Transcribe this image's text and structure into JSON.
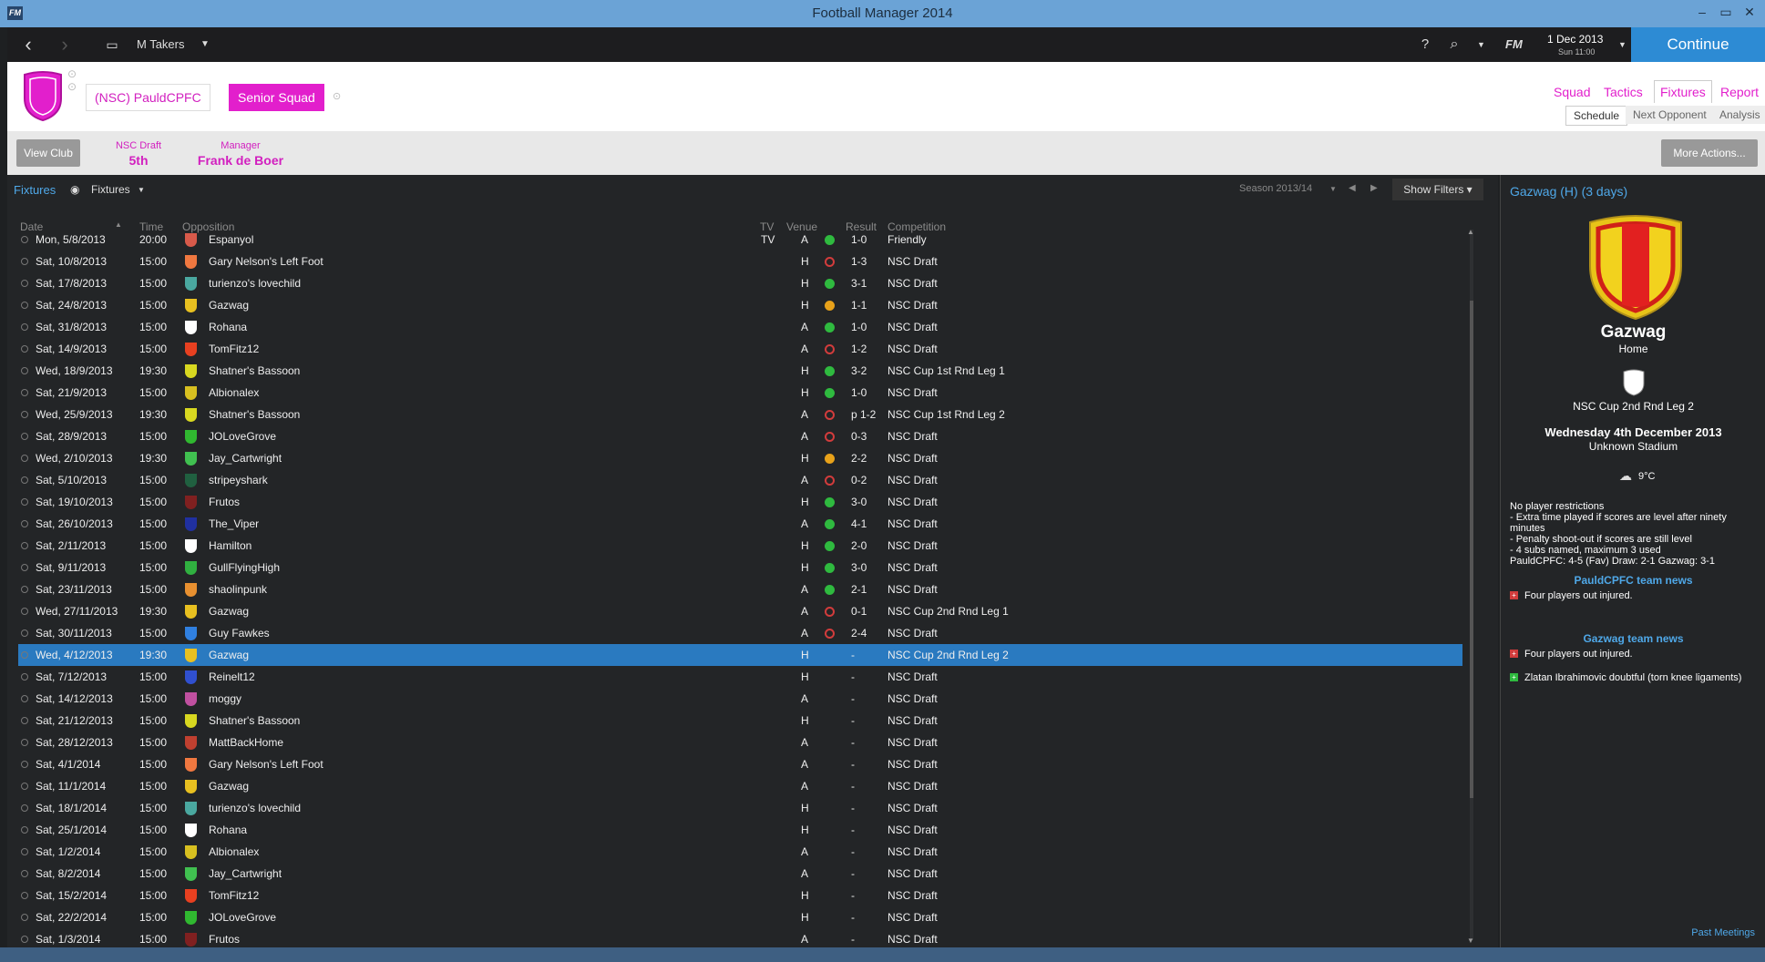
{
  "window": {
    "title": "Football Manager 2014",
    "logo": "FM"
  },
  "topnav": {
    "manager": "M Takers",
    "date": "1 Dec 2013",
    "time": "Sun 11:00",
    "fm_label": "FM",
    "continue": "Continue"
  },
  "club": {
    "name": "(NSC) PauldCPFC",
    "squad": "Senior Squad",
    "crest_color": "#e21fcc",
    "tabs": [
      "Squad",
      "Tactics",
      "Fixtures",
      "Report"
    ],
    "subtabs": [
      "Schedule",
      "Next Opponent",
      "Analysis"
    ]
  },
  "infobar": {
    "view_club": "View Club",
    "comp_label": "NSC Draft",
    "comp_value": "5th",
    "manager_label": "Manager",
    "manager_value": "Frank de Boer",
    "more_actions": "More Actions..."
  },
  "fixtures": {
    "breadcrumb": "Fixtures",
    "view": "Fixtures",
    "season": "Season 2013/14",
    "filters": "Show Filters",
    "columns": {
      "date": "Date",
      "time": "Time",
      "opposition": "Opposition",
      "tv": "TV",
      "venue": "Venue",
      "result": "Result",
      "competition": "Competition"
    },
    "rows": [
      {
        "date": "Mon, 5/8/2013",
        "time": "20:00",
        "opp": "Espanyol",
        "tv": "TV",
        "venue": "A",
        "outcome": "W",
        "result": "1-0",
        "comp": "Friendly",
        "crest": "#d85a4a"
      },
      {
        "date": "Sat, 10/8/2013",
        "time": "15:00",
        "opp": "Gary Nelson's Left Foot",
        "tv": "",
        "venue": "H",
        "outcome": "L",
        "result": "1-3",
        "comp": "NSC Draft",
        "crest": "#f07840"
      },
      {
        "date": "Sat, 17/8/2013",
        "time": "15:00",
        "opp": "turienzo's lovechild",
        "tv": "",
        "venue": "H",
        "outcome": "W",
        "result": "3-1",
        "comp": "NSC Draft",
        "crest": "#4aa8a0"
      },
      {
        "date": "Sat, 24/8/2013",
        "time": "15:00",
        "opp": "Gazwag",
        "tv": "",
        "venue": "H",
        "outcome": "D",
        "result": "1-1",
        "comp": "NSC Draft",
        "crest": "#e8c020"
      },
      {
        "date": "Sat, 31/8/2013",
        "time": "15:00",
        "opp": "Rohana",
        "tv": "",
        "venue": "A",
        "outcome": "W",
        "result": "1-0",
        "comp": "NSC Draft",
        "crest": "#ffffff"
      },
      {
        "date": "Sat, 14/9/2013",
        "time": "15:00",
        "opp": "TomFitz12",
        "tv": "",
        "venue": "A",
        "outcome": "L",
        "result": "1-2",
        "comp": "NSC Draft",
        "crest": "#e84020"
      },
      {
        "date": "Wed, 18/9/2013",
        "time": "19:30",
        "opp": "Shatner's Bassoon",
        "tv": "",
        "venue": "H",
        "outcome": "W",
        "result": "3-2",
        "comp": "NSC Cup 1st Rnd Leg 1",
        "crest": "#d8d820"
      },
      {
        "date": "Sat, 21/9/2013",
        "time": "15:00",
        "opp": "Albionalex",
        "tv": "",
        "venue": "H",
        "outcome": "W",
        "result": "1-0",
        "comp": "NSC Draft",
        "crest": "#d8c020"
      },
      {
        "date": "Wed, 25/9/2013",
        "time": "19:30",
        "opp": "Shatner's Bassoon",
        "tv": "",
        "venue": "A",
        "outcome": "L",
        "result": "p 1-2",
        "comp": "NSC Cup 1st Rnd Leg 2",
        "crest": "#d8d820"
      },
      {
        "date": "Sat, 28/9/2013",
        "time": "15:00",
        "opp": "JOLoveGrove",
        "tv": "",
        "venue": "A",
        "outcome": "L",
        "result": "0-3",
        "comp": "NSC Draft",
        "crest": "#30b830"
      },
      {
        "date": "Wed, 2/10/2013",
        "time": "19:30",
        "opp": "Jay_Cartwright",
        "tv": "",
        "venue": "H",
        "outcome": "D",
        "result": "2-2",
        "comp": "NSC Draft",
        "crest": "#40c050"
      },
      {
        "date": "Sat, 5/10/2013",
        "time": "15:00",
        "opp": "stripeyshark",
        "tv": "",
        "venue": "A",
        "outcome": "L",
        "result": "0-2",
        "comp": "NSC Draft",
        "crest": "#206040"
      },
      {
        "date": "Sat, 19/10/2013",
        "time": "15:00",
        "opp": "Frutos",
        "tv": "",
        "venue": "H",
        "outcome": "W",
        "result": "3-0",
        "comp": "NSC Draft",
        "crest": "#802020"
      },
      {
        "date": "Sat, 26/10/2013",
        "time": "15:00",
        "opp": "The_Viper",
        "tv": "",
        "venue": "A",
        "outcome": "W",
        "result": "4-1",
        "comp": "NSC Draft",
        "crest": "#2030a0"
      },
      {
        "date": "Sat, 2/11/2013",
        "time": "15:00",
        "opp": "Hamilton",
        "tv": "",
        "venue": "H",
        "outcome": "W",
        "result": "2-0",
        "comp": "NSC Draft",
        "crest": "#ffffff"
      },
      {
        "date": "Sat, 9/11/2013",
        "time": "15:00",
        "opp": "GullFlyingHigh",
        "tv": "",
        "venue": "H",
        "outcome": "W",
        "result": "3-0",
        "comp": "NSC Draft",
        "crest": "#30b040"
      },
      {
        "date": "Sat, 23/11/2013",
        "time": "15:00",
        "opp": "shaolinpunk",
        "tv": "",
        "venue": "A",
        "outcome": "W",
        "result": "2-1",
        "comp": "NSC Draft",
        "crest": "#e89030"
      },
      {
        "date": "Wed, 27/11/2013",
        "time": "19:30",
        "opp": "Gazwag",
        "tv": "",
        "venue": "A",
        "outcome": "L",
        "result": "0-1",
        "comp": "NSC Cup 2nd Rnd Leg 1",
        "crest": "#e8c020"
      },
      {
        "date": "Sat, 30/11/2013",
        "time": "15:00",
        "opp": "Guy Fawkes",
        "tv": "",
        "venue": "A",
        "outcome": "L",
        "result": "2-4",
        "comp": "NSC Draft",
        "crest": "#3080e0"
      },
      {
        "date": "Wed, 4/12/2013",
        "time": "19:30",
        "opp": "Gazwag",
        "tv": "",
        "venue": "H",
        "outcome": "",
        "result": "-",
        "comp": "NSC Cup 2nd Rnd Leg 2",
        "crest": "#e8c020",
        "selected": true
      },
      {
        "date": "Sat, 7/12/2013",
        "time": "15:00",
        "opp": "Reinelt12",
        "tv": "",
        "venue": "H",
        "outcome": "",
        "result": "-",
        "comp": "NSC Draft",
        "crest": "#3050d0"
      },
      {
        "date": "Sat, 14/12/2013",
        "time": "15:00",
        "opp": "moggy",
        "tv": "",
        "venue": "A",
        "outcome": "",
        "result": "-",
        "comp": "NSC Draft",
        "crest": "#c050a0"
      },
      {
        "date": "Sat, 21/12/2013",
        "time": "15:00",
        "opp": "Shatner's Bassoon",
        "tv": "",
        "venue": "H",
        "outcome": "",
        "result": "-",
        "comp": "NSC Draft",
        "crest": "#d8d820"
      },
      {
        "date": "Sat, 28/12/2013",
        "time": "15:00",
        "opp": "MattBackHome",
        "tv": "",
        "venue": "A",
        "outcome": "",
        "result": "-",
        "comp": "NSC Draft",
        "crest": "#c04030"
      },
      {
        "date": "Sat, 4/1/2014",
        "time": "15:00",
        "opp": "Gary Nelson's Left Foot",
        "tv": "",
        "venue": "A",
        "outcome": "",
        "result": "-",
        "comp": "NSC Draft",
        "crest": "#f07840"
      },
      {
        "date": "Sat, 11/1/2014",
        "time": "15:00",
        "opp": "Gazwag",
        "tv": "",
        "venue": "A",
        "outcome": "",
        "result": "-",
        "comp": "NSC Draft",
        "crest": "#e8c020"
      },
      {
        "date": "Sat, 18/1/2014",
        "time": "15:00",
        "opp": "turienzo's lovechild",
        "tv": "",
        "venue": "H",
        "outcome": "",
        "result": "-",
        "comp": "NSC Draft",
        "crest": "#4aa8a0"
      },
      {
        "date": "Sat, 25/1/2014",
        "time": "15:00",
        "opp": "Rohana",
        "tv": "",
        "venue": "H",
        "outcome": "",
        "result": "-",
        "comp": "NSC Draft",
        "crest": "#ffffff"
      },
      {
        "date": "Sat, 1/2/2014",
        "time": "15:00",
        "opp": "Albionalex",
        "tv": "",
        "venue": "A",
        "outcome": "",
        "result": "-",
        "comp": "NSC Draft",
        "crest": "#d8c020"
      },
      {
        "date": "Sat, 8/2/2014",
        "time": "15:00",
        "opp": "Jay_Cartwright",
        "tv": "",
        "venue": "A",
        "outcome": "",
        "result": "-",
        "comp": "NSC Draft",
        "crest": "#40c050"
      },
      {
        "date": "Sat, 15/2/2014",
        "time": "15:00",
        "opp": "TomFitz12",
        "tv": "",
        "venue": "H",
        "outcome": "",
        "result": "-",
        "comp": "NSC Draft",
        "crest": "#e84020"
      },
      {
        "date": "Sat, 22/2/2014",
        "time": "15:00",
        "opp": "JOLoveGrove",
        "tv": "",
        "venue": "H",
        "outcome": "",
        "result": "-",
        "comp": "NSC Draft",
        "crest": "#30b830"
      },
      {
        "date": "Sat, 1/3/2014",
        "time": "15:00",
        "opp": "Frutos",
        "tv": "",
        "venue": "A",
        "outcome": "",
        "result": "-",
        "comp": "NSC Draft",
        "crest": "#802020"
      }
    ]
  },
  "preview": {
    "header": "Gazwag (H) (3 days)",
    "team": "Gazwag",
    "venue_label": "Home",
    "competition": "NSC Cup 2nd Rnd Leg 2",
    "date": "Wednesday 4th December 2013",
    "stadium": "Unknown Stadium",
    "weather": "9°C",
    "rules": [
      "No player restrictions",
      "- Extra time played if scores are level after ninety minutes",
      "- Penalty shoot-out if scores are still level",
      "- 4 subs named, maximum 3 used",
      "PauldCPFC: 4-5 (Fav) Draw: 2-1 Gazwag: 3-1"
    ],
    "home_news_title": "PauldCPFC team news",
    "home_news": [
      "Four players out injured."
    ],
    "away_news_title": "Gazwag team news",
    "away_news": [
      "Four players out injured.",
      "Zlatan Ibrahimovic doubtful (torn knee ligaments)"
    ],
    "past_meetings": "Past Meetings"
  }
}
